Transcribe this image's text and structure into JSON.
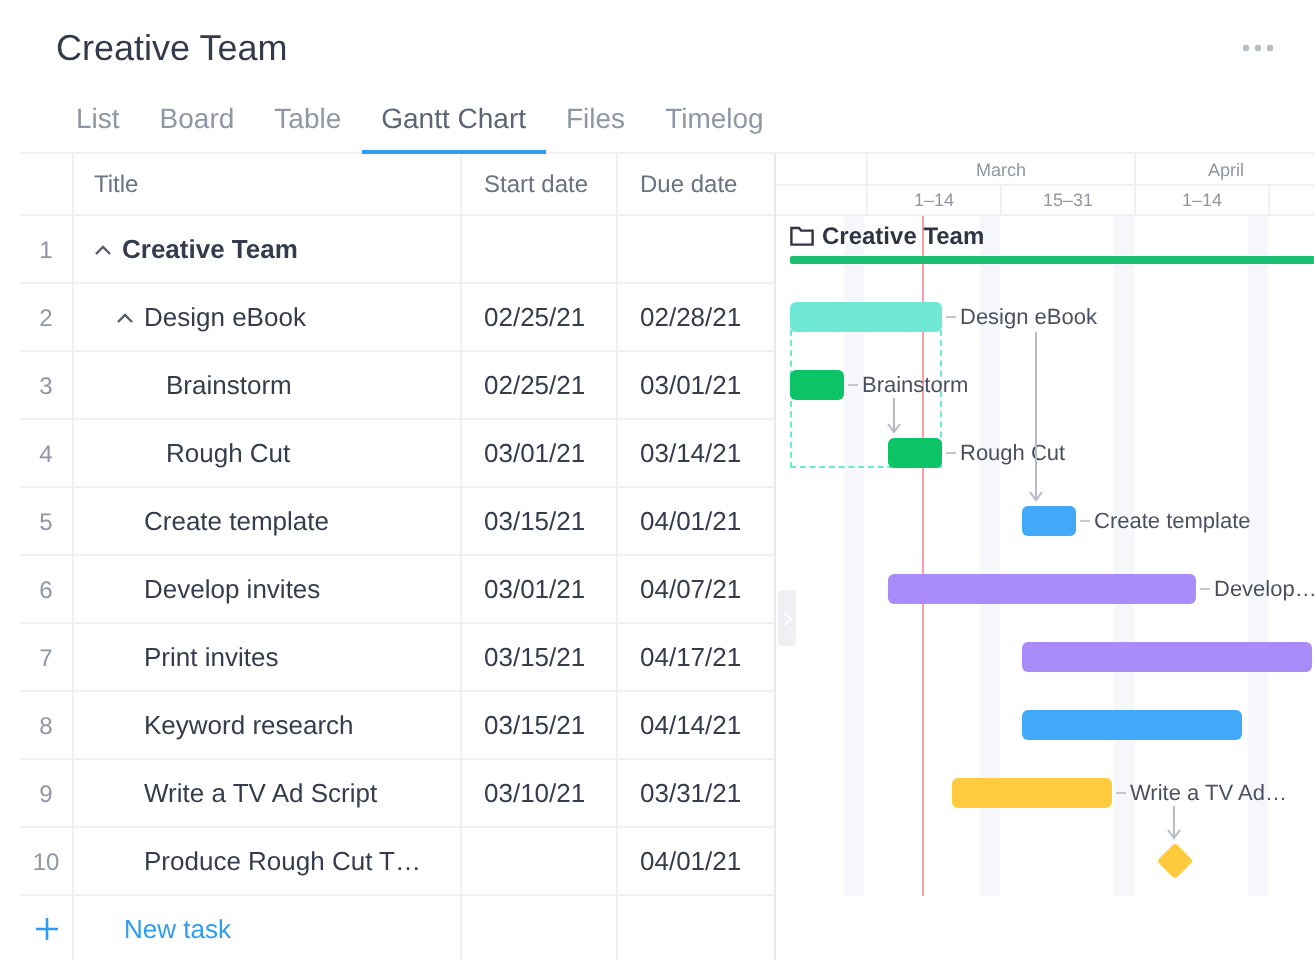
{
  "header": {
    "title": "Creative Team"
  },
  "tabs": [
    {
      "label": "List",
      "selected": false
    },
    {
      "label": "Board",
      "selected": false
    },
    {
      "label": "Table",
      "selected": false
    },
    {
      "label": "Gantt Chart",
      "selected": true
    },
    {
      "label": "Files",
      "selected": false
    },
    {
      "label": "Timelog",
      "selected": false
    }
  ],
  "table": {
    "columns": [
      "Title",
      "Start date",
      "Due date"
    ],
    "rows": [
      {
        "number": "1",
        "title": "Creative Team",
        "kind": "group",
        "expanded": true,
        "children": [
          {
            "number": "2",
            "title": "Design eBook",
            "start": "02/25/21",
            "due": "02/28/21",
            "kind": "task",
            "expanded": true,
            "children": [
              {
                "number": "3",
                "title": "Brainstorm",
                "start": "02/25/21",
                "due": "03/01/21",
                "kind": "task"
              },
              {
                "number": "4",
                "title": "Rough Cut",
                "start": "03/01/21",
                "due": "03/14/21",
                "kind": "task"
              }
            ]
          },
          {
            "number": "5",
            "title": "Create template",
            "start": "03/15/21",
            "due": "04/01/21",
            "kind": "task"
          },
          {
            "number": "6",
            "title": "Develop invites",
            "start": "03/01/21",
            "due": "04/07/21",
            "kind": "task"
          },
          {
            "number": "7",
            "title": "Print invites",
            "start": "03/15/21",
            "due": "04/17/21",
            "kind": "task"
          },
          {
            "number": "8",
            "title": "Keyword research",
            "start": "03/15/21",
            "due": "04/14/21",
            "kind": "task"
          },
          {
            "number": "9",
            "title": "Write a TV Ad Script",
            "start": "03/10/21",
            "due": "03/31/21",
            "kind": "task"
          },
          {
            "number": "10",
            "title": "Produce Rough Cut T…",
            "due": "04/01/21",
            "kind": "task"
          }
        ]
      }
    ],
    "new_task": "New task"
  },
  "gantt": {
    "months": [
      "March",
      "April"
    ],
    "periods": [
      "1–14",
      "15–31",
      "1–14"
    ],
    "bars": [
      {
        "kind": "summary",
        "label": "Creative Team",
        "color": "#1dbf73"
      },
      {
        "kind": "bar",
        "label": "Design eBook",
        "color": "#6fe8d6"
      },
      {
        "kind": "bar",
        "label": "Brainstorm",
        "color": "#0cc466"
      },
      {
        "kind": "bar",
        "label": "Rough Cut",
        "color": "#0cc466"
      },
      {
        "kind": "bar",
        "label": "Create template",
        "color": "#42a8f8"
      },
      {
        "kind": "bar",
        "label": "Develop…",
        "color": "#a98bf9"
      },
      {
        "kind": "bar",
        "color": "#a98bf9"
      },
      {
        "kind": "bar",
        "color": "#42a8f8"
      },
      {
        "kind": "bar",
        "label": "Write a TV Ad…",
        "color": "#ffca3d"
      },
      {
        "kind": "milestone",
        "color": "#ffca3d"
      }
    ]
  }
}
